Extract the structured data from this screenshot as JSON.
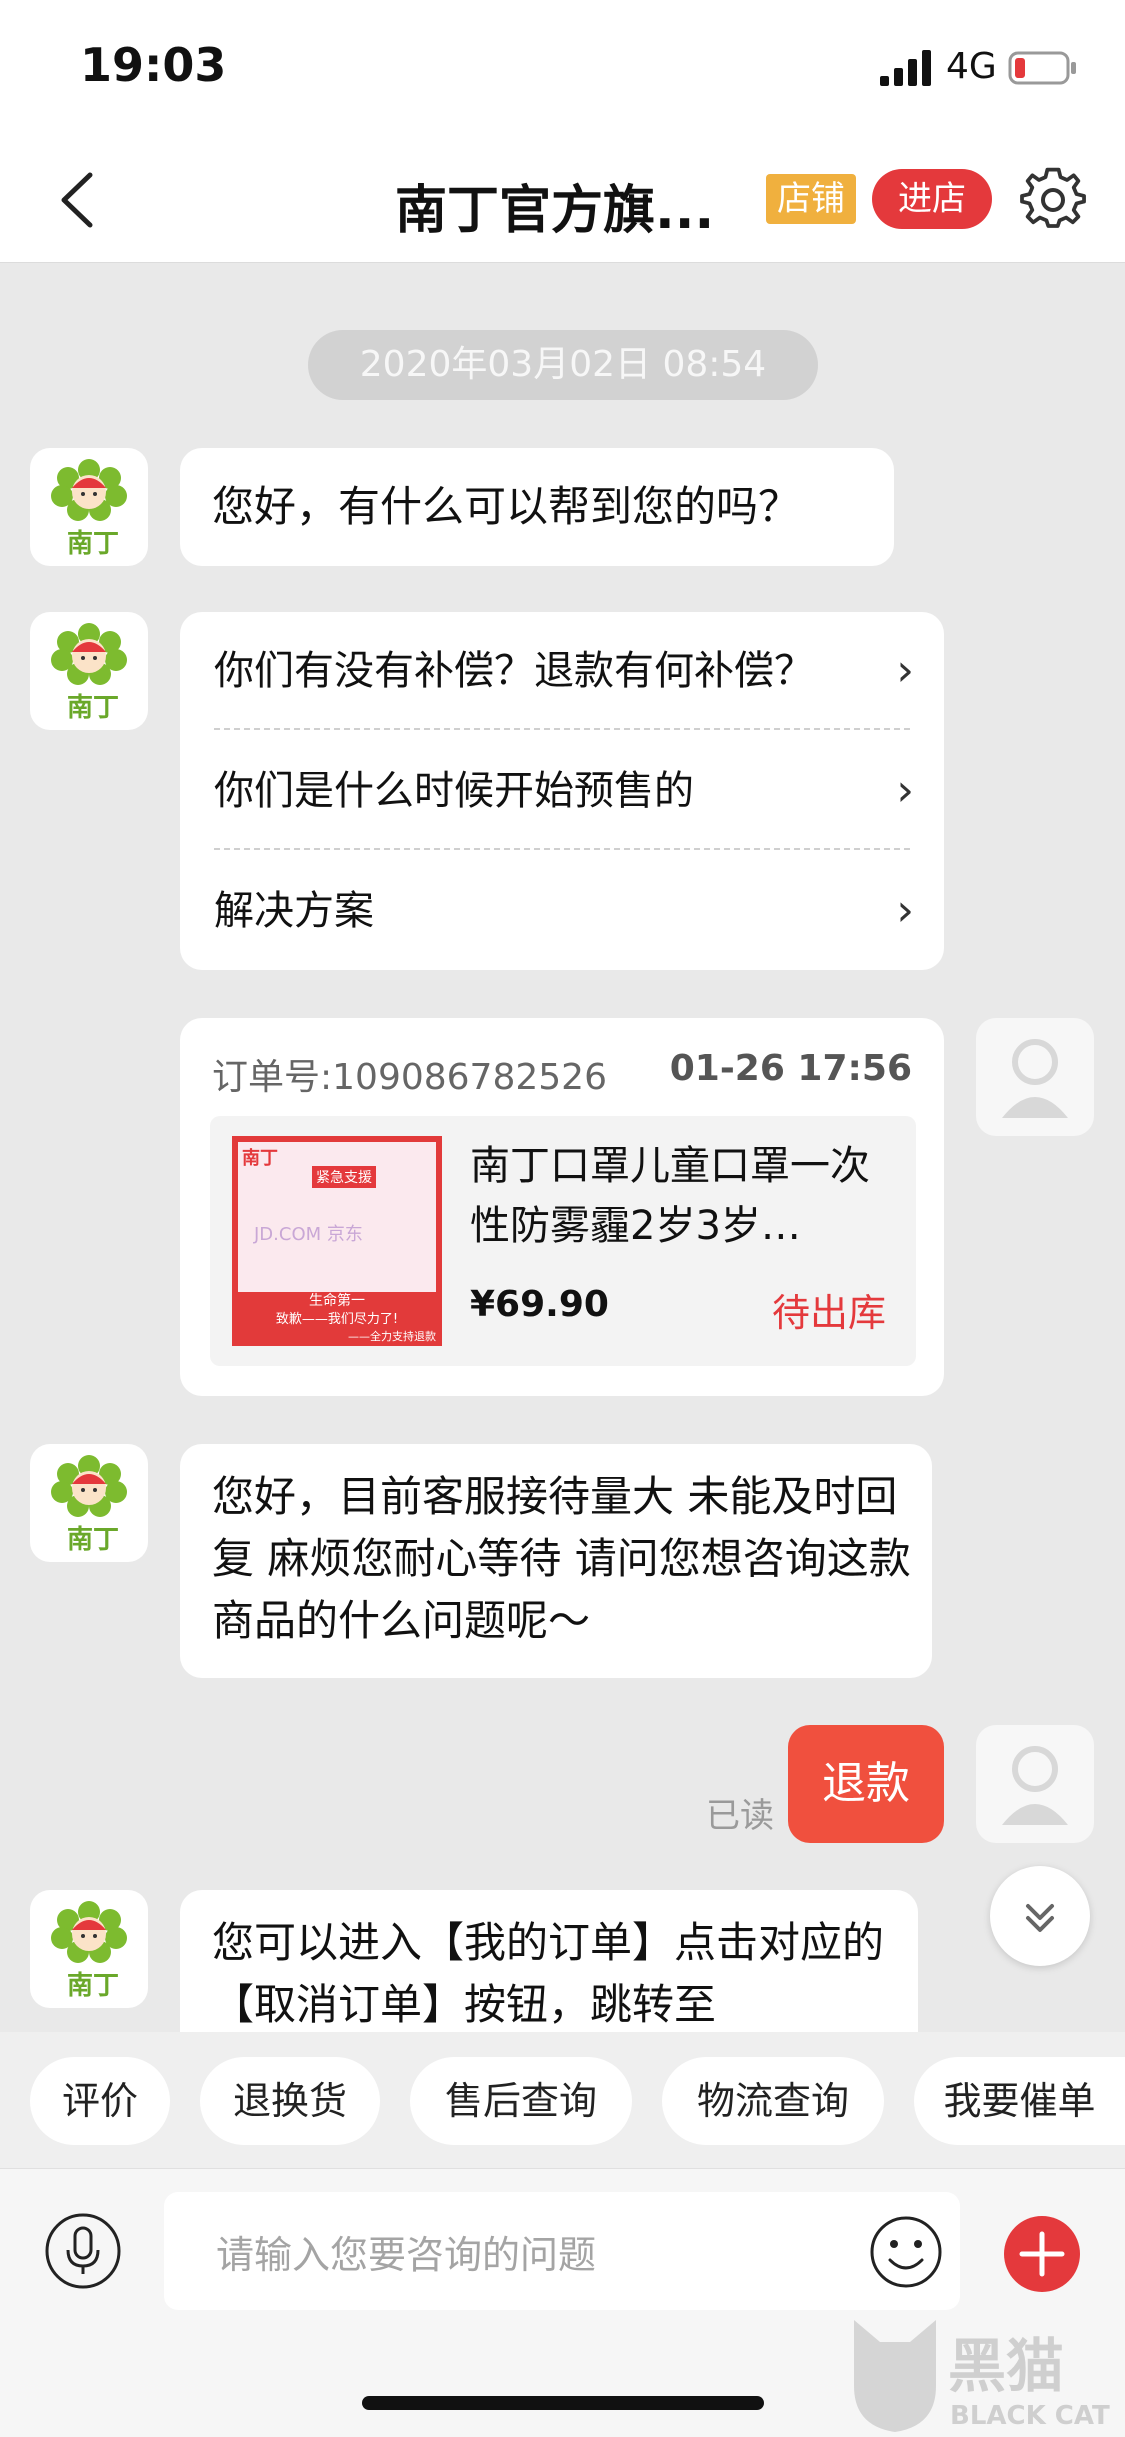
{
  "status_bar": {
    "time": "19:03",
    "network": "4G"
  },
  "nav": {
    "title": "南丁官方旗...",
    "shop_badge": "店铺",
    "enter_store": "进店"
  },
  "chat": {
    "timestamp": "2020年03月02日 08:54",
    "merchant_avatar_label": "南丁",
    "msg1": "您好，有什么可以帮到您的吗？",
    "menu": [
      {
        "label": "你们有没有补偿？退款有何补偿？"
      },
      {
        "label": "你们是什么时候开始预售的"
      },
      {
        "label": "解决方案"
      }
    ],
    "order": {
      "order_no": "订单号:109086782526",
      "time": "01-26 17:56",
      "product_name": "南丁口罩儿童口罩一次性防雾霾2岁3岁…",
      "price": "¥69.90",
      "status": "待出库",
      "image_texts": {
        "brand": "南丁",
        "tag": "紧急支援",
        "site": "JD.COM 京东",
        "line1": "生命第一",
        "line2": "致歉——我们尽力了!",
        "line3": "——全力支持退款"
      }
    },
    "msg3": "您好，目前客服接待量大 未能及时回复 麻烦您耐心等待 请问您想咨询这款商品的什么问题呢～",
    "read_mark": "已读",
    "msg4": "退款",
    "msg5": " 您可以进入【我的订单】点击对应的【取消订单】按钮，跳转至"
  },
  "quick_actions": [
    "评价",
    "退换货",
    "售后查询",
    "物流查询",
    "我要催单"
  ],
  "input": {
    "placeholder": "请输入您要咨询的问题"
  },
  "watermark": {
    "cn": "黑猫",
    "en": "BLACK CAT"
  },
  "colors": {
    "accent": "#e4393c",
    "badge": "#f0b03e",
    "user_bubble": "#f0503e",
    "chat_bg": "#e9e9e9"
  }
}
